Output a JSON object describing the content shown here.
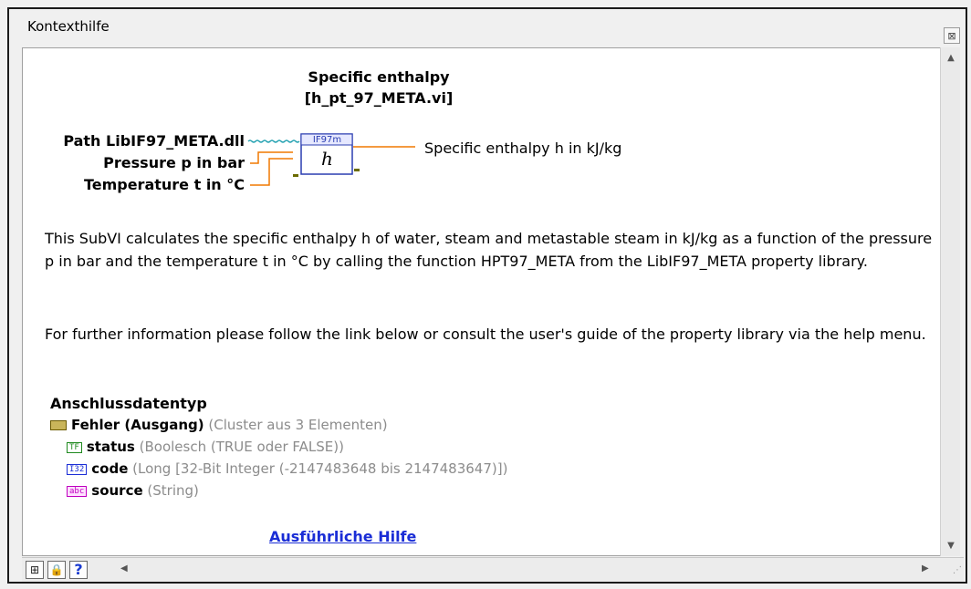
{
  "window": {
    "title": "Kontexthilfe",
    "close_glyph": "⊠"
  },
  "heading": {
    "line1": "Specific enthalpy",
    "line2": "[h_pt_97_META.vi]"
  },
  "connector": {
    "inputs": [
      "Path LibIF97_META.dll",
      "Pressure p in bar",
      "Temperature t in °C"
    ],
    "output": "Specific enthalpy h in kJ/kg",
    "icon_top_label": "IF97m",
    "icon_symbol": "h",
    "colors": {
      "path_wire": "#21a0b0",
      "numeric_wire": "#f07800",
      "icon_border": "#2a3db0"
    }
  },
  "description": {
    "p1": "This SubVI calculates the specific enthalpy h of water, steam and metastable steam in kJ/kg as a function of the pressure p in bar and the temperature t in °C by calling the function HPT97_META from the LibIF97_META property library.",
    "p2": "For further information please follow the link below or consult the user's guide of the property library via the help menu."
  },
  "datatype": {
    "heading": "Anschlussdatentyp",
    "rows": [
      {
        "icon": "cluster-icon",
        "name": "Fehler (Ausgang)",
        "desc": "(Cluster aus 3 Elementen)"
      },
      {
        "icon": "boolean-icon",
        "icon_text": "TF",
        "name": "status",
        "desc": "(Boolesch (TRUE oder FALSE))"
      },
      {
        "icon": "integer-icon",
        "icon_text": "I32",
        "name": "code",
        "desc": "(Long [32-Bit Integer (-2147483648 bis 2147483647)])"
      },
      {
        "icon": "string-icon",
        "icon_text": "abc",
        "name": "source",
        "desc": "(String)"
      }
    ]
  },
  "link": {
    "label": "Ausführliche Hilfe"
  },
  "toolbar": {
    "buttons": [
      {
        "icon": "show-optional-terminals-icon",
        "glyph": "⊞"
      },
      {
        "icon": "lock-icon",
        "glyph": "🔒"
      },
      {
        "icon": "help-icon",
        "glyph": "?"
      }
    ]
  }
}
